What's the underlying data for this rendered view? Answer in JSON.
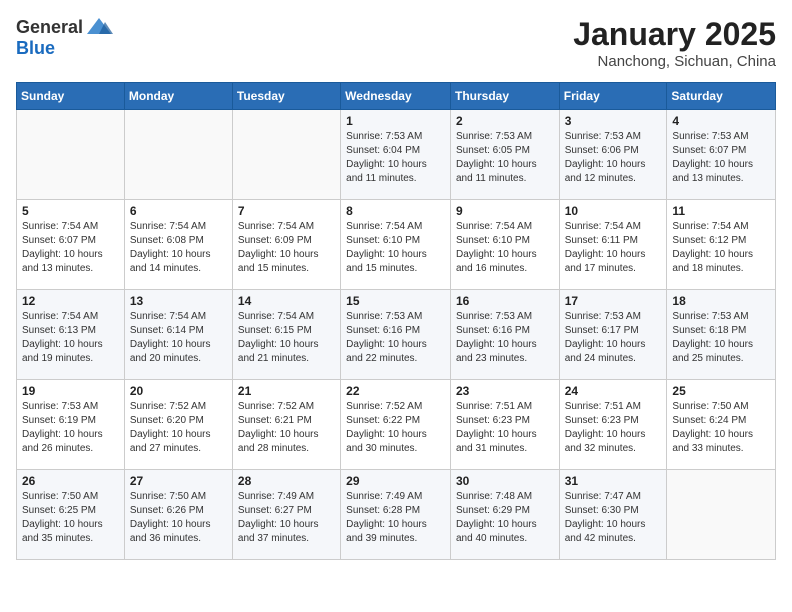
{
  "header": {
    "logo_general": "General",
    "logo_blue": "Blue",
    "month_title": "January 2025",
    "location": "Nanchong, Sichuan, China"
  },
  "days_of_week": [
    "Sunday",
    "Monday",
    "Tuesday",
    "Wednesday",
    "Thursday",
    "Friday",
    "Saturday"
  ],
  "weeks": [
    [
      {
        "day": "",
        "info": ""
      },
      {
        "day": "",
        "info": ""
      },
      {
        "day": "",
        "info": ""
      },
      {
        "day": "1",
        "info": "Sunrise: 7:53 AM\nSunset: 6:04 PM\nDaylight: 10 hours and 11 minutes."
      },
      {
        "day": "2",
        "info": "Sunrise: 7:53 AM\nSunset: 6:05 PM\nDaylight: 10 hours and 11 minutes."
      },
      {
        "day": "3",
        "info": "Sunrise: 7:53 AM\nSunset: 6:06 PM\nDaylight: 10 hours and 12 minutes."
      },
      {
        "day": "4",
        "info": "Sunrise: 7:53 AM\nSunset: 6:07 PM\nDaylight: 10 hours and 13 minutes."
      }
    ],
    [
      {
        "day": "5",
        "info": "Sunrise: 7:54 AM\nSunset: 6:07 PM\nDaylight: 10 hours and 13 minutes."
      },
      {
        "day": "6",
        "info": "Sunrise: 7:54 AM\nSunset: 6:08 PM\nDaylight: 10 hours and 14 minutes."
      },
      {
        "day": "7",
        "info": "Sunrise: 7:54 AM\nSunset: 6:09 PM\nDaylight: 10 hours and 15 minutes."
      },
      {
        "day": "8",
        "info": "Sunrise: 7:54 AM\nSunset: 6:10 PM\nDaylight: 10 hours and 15 minutes."
      },
      {
        "day": "9",
        "info": "Sunrise: 7:54 AM\nSunset: 6:10 PM\nDaylight: 10 hours and 16 minutes."
      },
      {
        "day": "10",
        "info": "Sunrise: 7:54 AM\nSunset: 6:11 PM\nDaylight: 10 hours and 17 minutes."
      },
      {
        "day": "11",
        "info": "Sunrise: 7:54 AM\nSunset: 6:12 PM\nDaylight: 10 hours and 18 minutes."
      }
    ],
    [
      {
        "day": "12",
        "info": "Sunrise: 7:54 AM\nSunset: 6:13 PM\nDaylight: 10 hours and 19 minutes."
      },
      {
        "day": "13",
        "info": "Sunrise: 7:54 AM\nSunset: 6:14 PM\nDaylight: 10 hours and 20 minutes."
      },
      {
        "day": "14",
        "info": "Sunrise: 7:54 AM\nSunset: 6:15 PM\nDaylight: 10 hours and 21 minutes."
      },
      {
        "day": "15",
        "info": "Sunrise: 7:53 AM\nSunset: 6:16 PM\nDaylight: 10 hours and 22 minutes."
      },
      {
        "day": "16",
        "info": "Sunrise: 7:53 AM\nSunset: 6:16 PM\nDaylight: 10 hours and 23 minutes."
      },
      {
        "day": "17",
        "info": "Sunrise: 7:53 AM\nSunset: 6:17 PM\nDaylight: 10 hours and 24 minutes."
      },
      {
        "day": "18",
        "info": "Sunrise: 7:53 AM\nSunset: 6:18 PM\nDaylight: 10 hours and 25 minutes."
      }
    ],
    [
      {
        "day": "19",
        "info": "Sunrise: 7:53 AM\nSunset: 6:19 PM\nDaylight: 10 hours and 26 minutes."
      },
      {
        "day": "20",
        "info": "Sunrise: 7:52 AM\nSunset: 6:20 PM\nDaylight: 10 hours and 27 minutes."
      },
      {
        "day": "21",
        "info": "Sunrise: 7:52 AM\nSunset: 6:21 PM\nDaylight: 10 hours and 28 minutes."
      },
      {
        "day": "22",
        "info": "Sunrise: 7:52 AM\nSunset: 6:22 PM\nDaylight: 10 hours and 30 minutes."
      },
      {
        "day": "23",
        "info": "Sunrise: 7:51 AM\nSunset: 6:23 PM\nDaylight: 10 hours and 31 minutes."
      },
      {
        "day": "24",
        "info": "Sunrise: 7:51 AM\nSunset: 6:23 PM\nDaylight: 10 hours and 32 minutes."
      },
      {
        "day": "25",
        "info": "Sunrise: 7:50 AM\nSunset: 6:24 PM\nDaylight: 10 hours and 33 minutes."
      }
    ],
    [
      {
        "day": "26",
        "info": "Sunrise: 7:50 AM\nSunset: 6:25 PM\nDaylight: 10 hours and 35 minutes."
      },
      {
        "day": "27",
        "info": "Sunrise: 7:50 AM\nSunset: 6:26 PM\nDaylight: 10 hours and 36 minutes."
      },
      {
        "day": "28",
        "info": "Sunrise: 7:49 AM\nSunset: 6:27 PM\nDaylight: 10 hours and 37 minutes."
      },
      {
        "day": "29",
        "info": "Sunrise: 7:49 AM\nSunset: 6:28 PM\nDaylight: 10 hours and 39 minutes."
      },
      {
        "day": "30",
        "info": "Sunrise: 7:48 AM\nSunset: 6:29 PM\nDaylight: 10 hours and 40 minutes."
      },
      {
        "day": "31",
        "info": "Sunrise: 7:47 AM\nSunset: 6:30 PM\nDaylight: 10 hours and 42 minutes."
      },
      {
        "day": "",
        "info": ""
      }
    ]
  ]
}
